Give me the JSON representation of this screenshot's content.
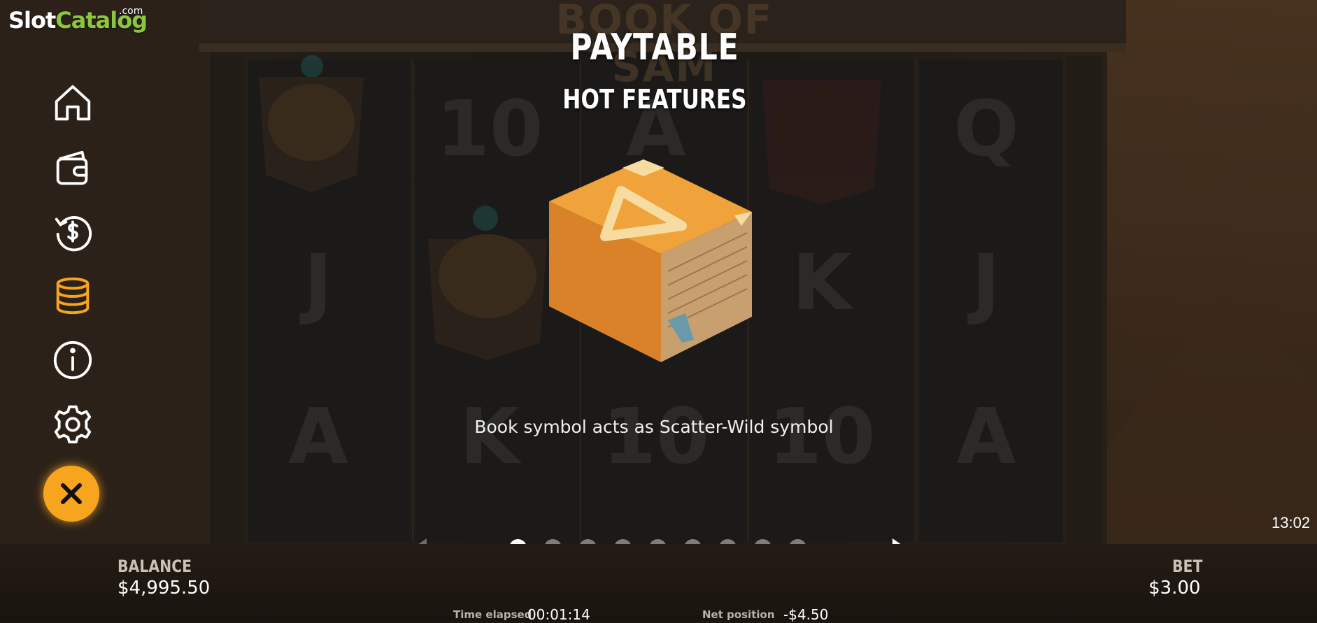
{
  "branding": {
    "site_name_part1": "Slot",
    "site_name_part2": "Catalog",
    "site_suffix": ".com"
  },
  "game": {
    "title_logo": "BOOK OF SAM"
  },
  "paytable": {
    "title": "PAYTABLE",
    "subtitle": "HOT FEATURES",
    "description": "Book symbol acts as Scatter-Wild symbol",
    "page_count": 9,
    "active_page": 1
  },
  "reels": {
    "symbols": [
      "10",
      "A",
      "Q",
      "J",
      "K",
      "J",
      "A",
      "K",
      "10",
      "10",
      "A"
    ]
  },
  "sidebar": {
    "items": [
      {
        "name": "home",
        "icon": "home-icon"
      },
      {
        "name": "wallet",
        "icon": "wallet-icon"
      },
      {
        "name": "history",
        "icon": "history-dollar-icon"
      },
      {
        "name": "paytable",
        "icon": "coins-stack-icon",
        "active": true
      },
      {
        "name": "info",
        "icon": "info-icon"
      },
      {
        "name": "settings",
        "icon": "gear-icon"
      }
    ],
    "close": {
      "icon": "close-icon"
    }
  },
  "status": {
    "clock": "13:02",
    "balance_label": "BALANCE",
    "balance_value": "$4,995.50",
    "bet_label": "BET",
    "bet_value": "$3.00",
    "time_elapsed_label": "Time elapsed",
    "time_elapsed_value": "00:01:14",
    "net_position_label": "Net position",
    "net_position_value": "-$4.50"
  },
  "colors": {
    "accent": "#f7a51e",
    "brand_green": "#8cc63f",
    "dot_active": "#ffffff",
    "dot_inactive": "#7d7d7d"
  }
}
